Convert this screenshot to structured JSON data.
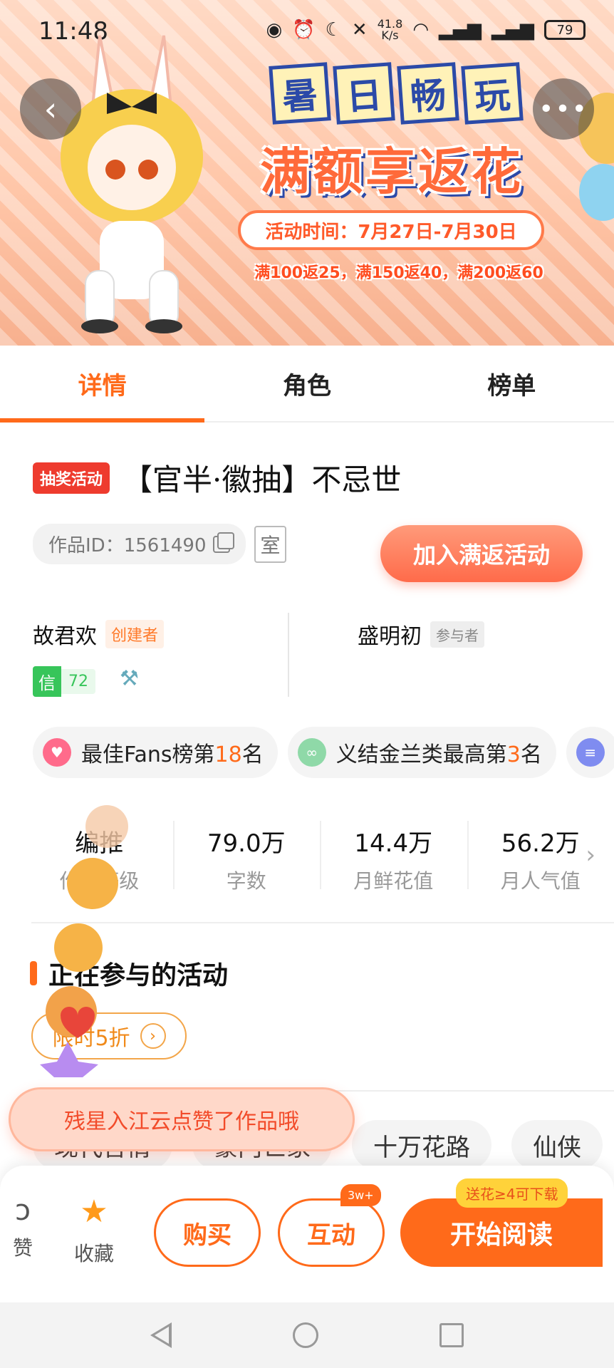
{
  "status_bar": {
    "time": "11:48",
    "net_speed_value": "41.8",
    "net_speed_unit": "K/s",
    "battery": "79"
  },
  "banner": {
    "title_chars": [
      "暑",
      "日",
      "畅",
      "玩"
    ],
    "headline": "满额享返花",
    "event_time": "活动时间：7月27日-7月30日",
    "rebate": "满100返25，满150返40，满200返60"
  },
  "tabs": [
    {
      "label": "详情",
      "active": true
    },
    {
      "label": "角色",
      "active": false
    },
    {
      "label": "榜单",
      "active": false
    }
  ],
  "work": {
    "badge": "抽奖活动",
    "title": "【官半·徽抽】不忌世",
    "id_label": "作品ID：1561490",
    "room": "室",
    "join_button": "加入满返活动"
  },
  "authors": {
    "creator_name": "故君欢",
    "creator_role": "创建者",
    "member_name": "盛明初",
    "member_role": "参与者",
    "trust_label": "信",
    "trust_value": "72"
  },
  "rankings": [
    {
      "pre": "最佳Fans榜第",
      "num": "18",
      "post": "名",
      "icon_color": "#ff6b8b"
    },
    {
      "pre": "义结金兰类最高第",
      "num": "3",
      "post": "名",
      "icon_color": "#8fd9a8"
    }
  ],
  "stats": [
    {
      "value": "编推",
      "label": "作品等级"
    },
    {
      "value": "79.0万",
      "label": "字数"
    },
    {
      "value": "14.4万",
      "label": "月鲜花值"
    },
    {
      "value": "56.2万",
      "label": "月人气值"
    }
  ],
  "activities": {
    "title": "正在参与的活动",
    "discount": "限时5折"
  },
  "tags": [
    "现代言情",
    "豪门世家",
    "十万花路",
    "仙侠"
  ],
  "toast": "残星入江云点赞了作品哦",
  "bottom_bar": {
    "like_label": "赞",
    "favorite_label": "收藏",
    "buy": "购买",
    "interact": "互动",
    "interact_badge": "3w+",
    "read": "开始阅读",
    "read_tip": "送花≥4可下载"
  },
  "colors": {
    "accent": "#ff6a1a",
    "lottery_badge": "#ee3b2e",
    "trust_green": "#37c55a"
  }
}
